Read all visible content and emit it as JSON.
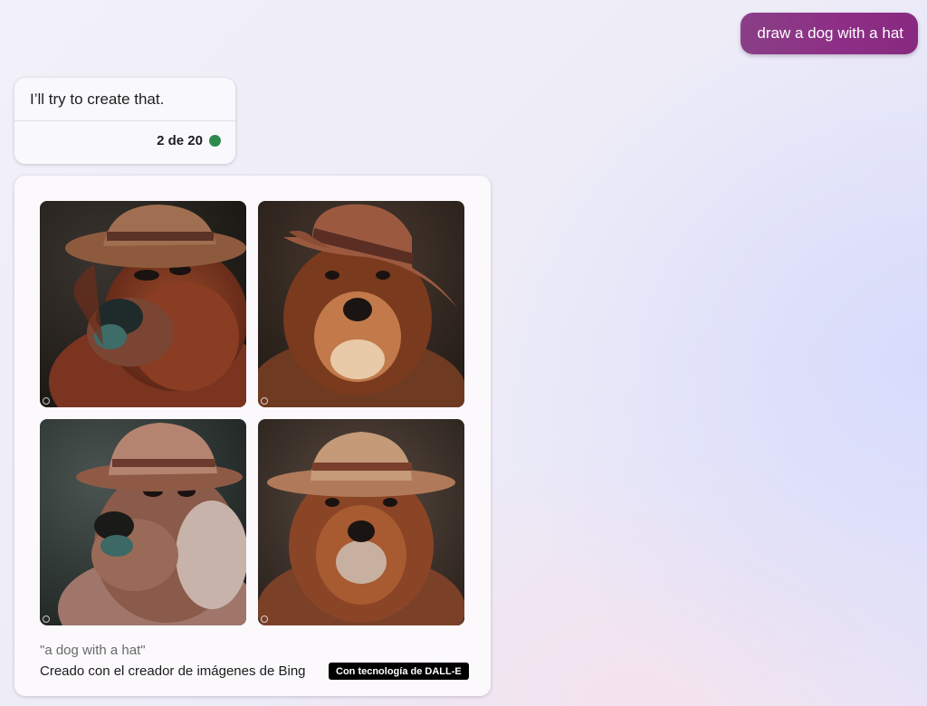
{
  "user_message": {
    "text": "draw a dog with a hat"
  },
  "bot_message": {
    "text": "I’ll try to create that.",
    "turn_counter": "2 de 20",
    "status_color": "#2f8a4e"
  },
  "image_result": {
    "images": [
      {
        "label": "dog-with-hat-image-1",
        "icon": "bing-logo-icon"
      },
      {
        "label": "dog-with-hat-image-2",
        "icon": "bing-logo-icon"
      },
      {
        "label": "dog-with-hat-image-3",
        "icon": "bing-logo-icon"
      },
      {
        "label": "dog-with-hat-image-4",
        "icon": "bing-logo-icon"
      }
    ],
    "prompt": "\"a dog with a hat\"",
    "creator": "Creado con el creador de imágenes de Bing",
    "badge": "Con tecnología de DALL-E"
  },
  "colors": {
    "user_bubble": "#8d2f86",
    "badge_bg": "#000000"
  }
}
